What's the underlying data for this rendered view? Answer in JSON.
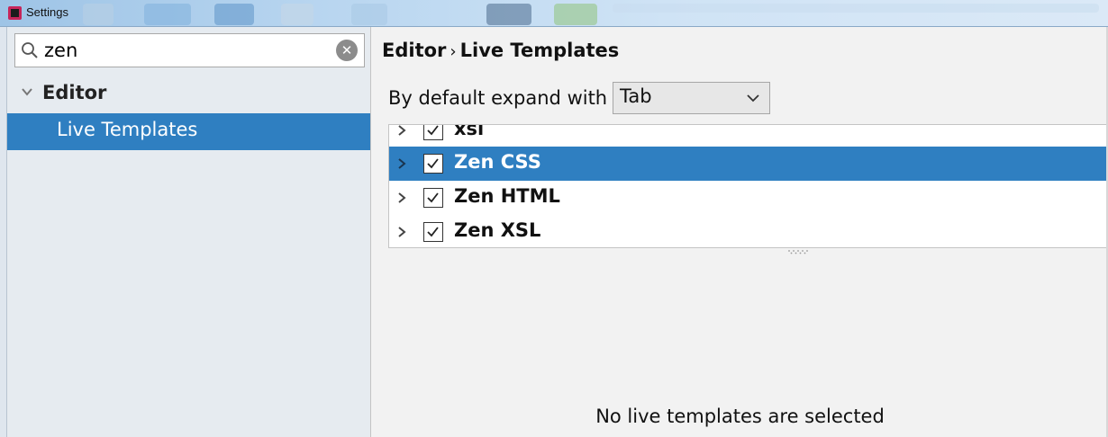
{
  "window": {
    "title": "Settings"
  },
  "search": {
    "value": "zen"
  },
  "sidebar": {
    "items": [
      {
        "label": "Editor",
        "expanded": true
      },
      {
        "label": "Live Templates",
        "selected": true
      }
    ]
  },
  "main": {
    "breadcrumb": {
      "parent": "Editor",
      "separator": "›",
      "current": "Live Templates"
    },
    "expand_with": {
      "label": "By default expand with",
      "value": "Tab"
    },
    "template_groups": [
      {
        "label": "xsl",
        "checked": true,
        "selected": false
      },
      {
        "label": "Zen CSS",
        "checked": true,
        "selected": true
      },
      {
        "label": "Zen HTML",
        "checked": true,
        "selected": false
      },
      {
        "label": "Zen XSL",
        "checked": true,
        "selected": false
      }
    ],
    "empty_message": "No live templates are selected"
  },
  "colors": {
    "selection": "#2f7fc1",
    "sidebar_bg": "#e6ebf0",
    "panel_bg": "#f2f2f2"
  },
  "icons": [
    "app-icon",
    "search-icon",
    "clear-icon",
    "chevron-down-icon",
    "chevron-right-icon",
    "checkbox-checked-icon"
  ]
}
